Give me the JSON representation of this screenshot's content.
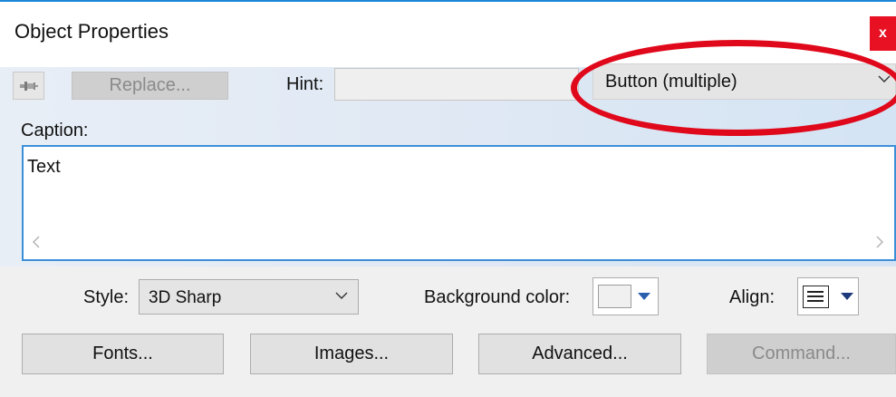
{
  "window": {
    "title": "Object Properties",
    "close_glyph": "x",
    "accent": "#1c86d8",
    "close_color": "#e81123"
  },
  "toolbar": {
    "pin_icon": "pushpin-icon",
    "replace_label": "Replace...",
    "hint_label": "Hint:",
    "hint_value": "",
    "type_value": "Button (multiple)"
  },
  "caption": {
    "label": "Caption:",
    "text": "Text",
    "scroll_left": "<",
    "scroll_right": ">"
  },
  "appearance": {
    "style_label": "Style:",
    "style_value": "3D Sharp",
    "background_label": "Background color:",
    "background_value": "#f0f0f0",
    "align_label": "Align:",
    "align_icon": "align-left-icon"
  },
  "buttons": {
    "fonts": "Fonts...",
    "images": "Images...",
    "advanced": "Advanced...",
    "command": "Command..."
  },
  "annotation": {
    "highlight_color": "#e0081b"
  }
}
